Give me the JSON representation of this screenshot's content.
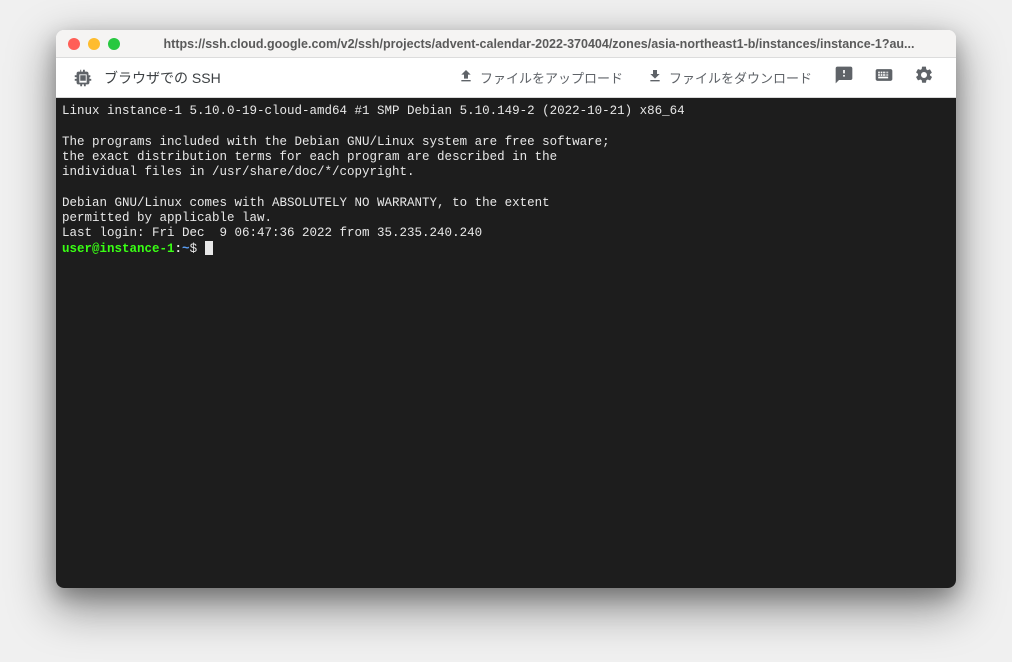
{
  "titlebar": {
    "url": "https://ssh.cloud.google.com/v2/ssh/projects/advent-calendar-2022-370404/zones/asia-northeast1-b/instances/instance-1?au..."
  },
  "toolbar": {
    "title": "ブラウザでの SSH",
    "upload_label": "ファイルをアップロード",
    "download_label": "ファイルをダウンロード"
  },
  "terminal": {
    "motd_line1": "Linux instance-1 5.10.0-19-cloud-amd64 #1 SMP Debian 5.10.149-2 (2022-10-21) x86_64",
    "motd_line2": "The programs included with the Debian GNU/Linux system are free software;",
    "motd_line3": "the exact distribution terms for each program are described in the",
    "motd_line4": "individual files in /usr/share/doc/*/copyright.",
    "motd_line5": "Debian GNU/Linux comes with ABSOLUTELY NO WARRANTY, to the extent",
    "motd_line6": "permitted by applicable law.",
    "last_login": "Last login: Fri Dec  9 06:47:36 2022 from 35.235.240.240",
    "prompt_user": "user@instance-1",
    "prompt_colon": ":",
    "prompt_path": "~",
    "prompt_symbol": "$ "
  }
}
